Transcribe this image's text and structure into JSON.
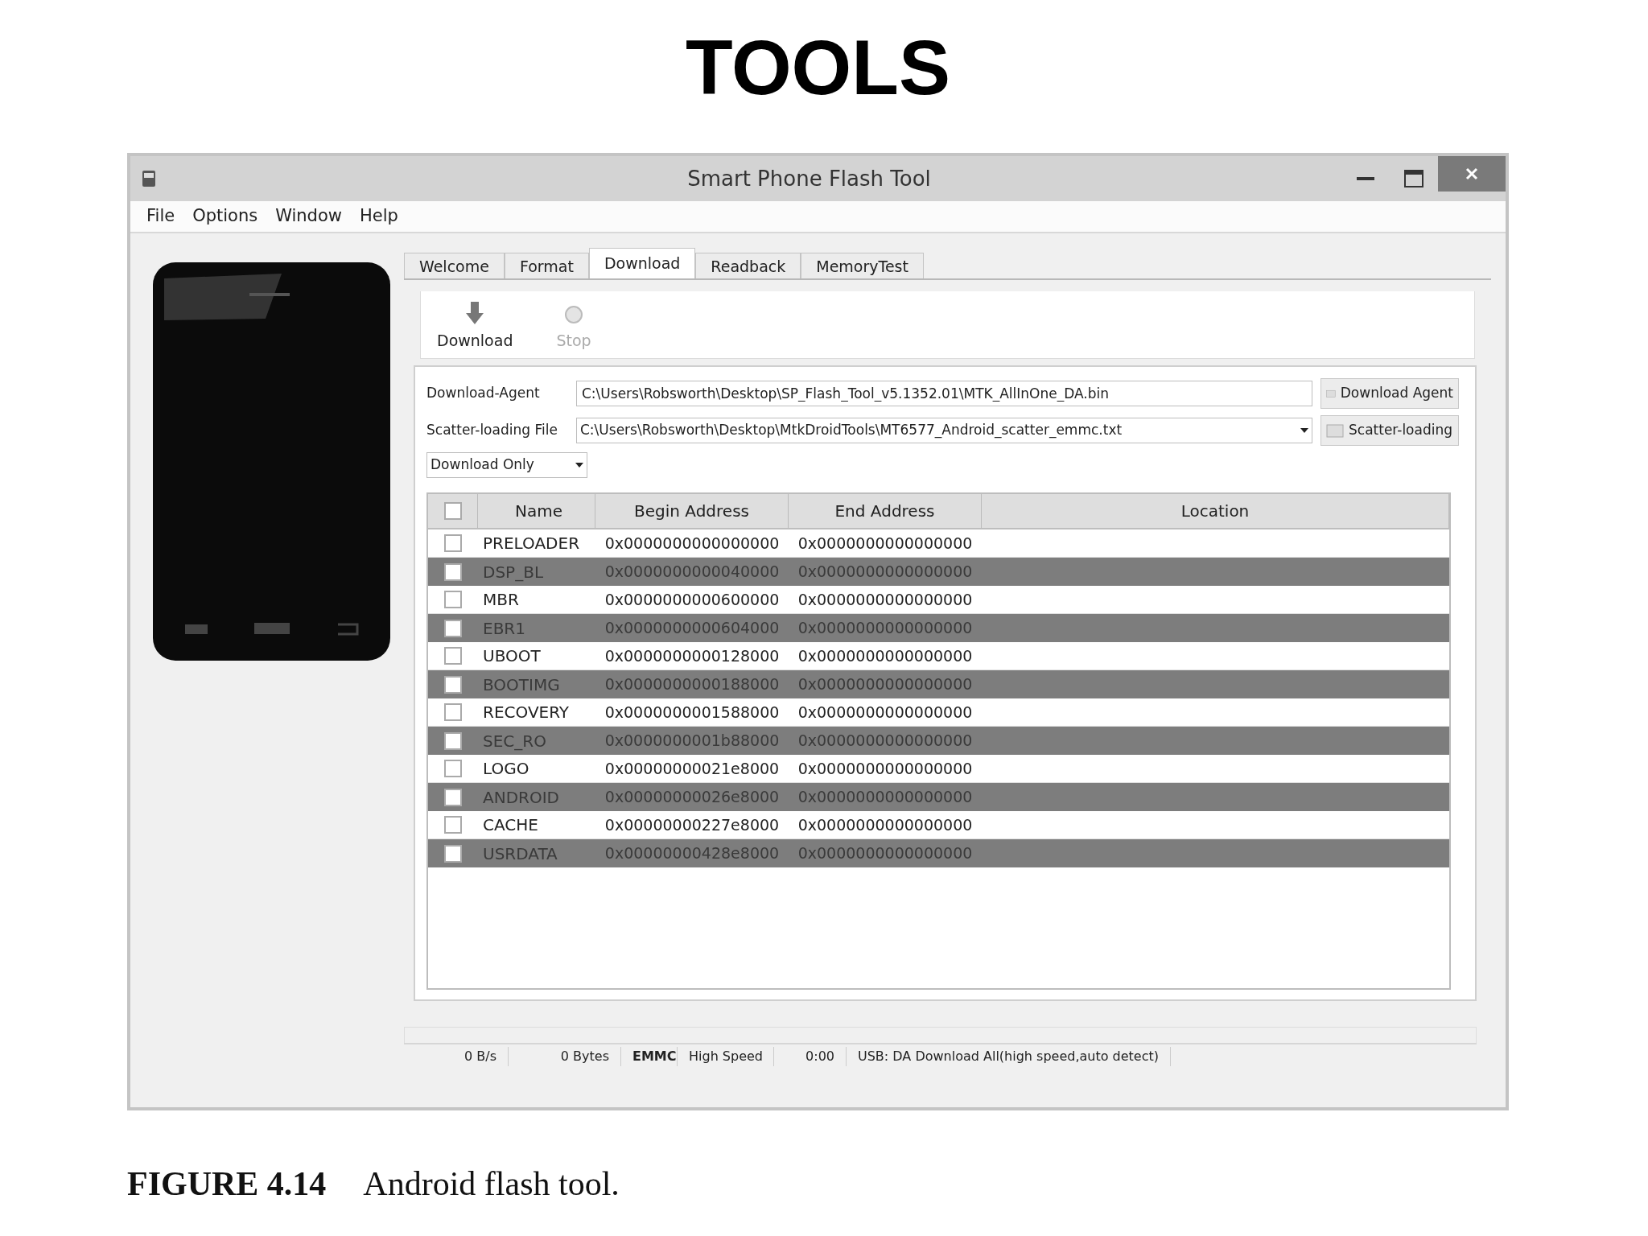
{
  "heading": "TOOLS",
  "window": {
    "title": "Smart Phone Flash Tool"
  },
  "menu": [
    "File",
    "Options",
    "Window",
    "Help"
  ],
  "tabs": [
    {
      "label": "Welcome",
      "selected": false
    },
    {
      "label": "Format",
      "selected": false
    },
    {
      "label": "Download",
      "selected": true
    },
    {
      "label": "Readback",
      "selected": false
    },
    {
      "label": "MemoryTest",
      "selected": false
    }
  ],
  "toolbar": [
    {
      "label": "Download",
      "kind": "download",
      "disabled": false
    },
    {
      "label": "Stop",
      "kind": "stop",
      "disabled": true
    }
  ],
  "download_agent": {
    "label": "Download-Agent",
    "value": "C:\\Users\\Robsworth\\Desktop\\SP_Flash_Tool_v5.1352.01\\MTK_AllInOne_DA.bin",
    "button": "Download Agent"
  },
  "scatter_file": {
    "label": "Scatter-loading File",
    "value": "C:\\Users\\Robsworth\\Desktop\\MtkDroidTools\\MT6577_Android_scatter_emmc.txt",
    "button": "Scatter-loading"
  },
  "mode": {
    "value": "Download Only"
  },
  "table": {
    "all_checked": false,
    "columns": [
      "Name",
      "Begin Address",
      "End Address",
      "Location"
    ],
    "rows": [
      {
        "name": "PRELOADER",
        "begin": "0x0000000000000000",
        "end": "0x0000000000000000",
        "checked": false,
        "selected": false
      },
      {
        "name": "DSP_BL",
        "begin": "0x0000000000040000",
        "end": "0x0000000000000000",
        "checked": false,
        "selected": true
      },
      {
        "name": "MBR",
        "begin": "0x0000000000600000",
        "end": "0x0000000000000000",
        "checked": false,
        "selected": false
      },
      {
        "name": "EBR1",
        "begin": "0x0000000000604000",
        "end": "0x0000000000000000",
        "checked": false,
        "selected": true
      },
      {
        "name": "UBOOT",
        "begin": "0x0000000000128000",
        "end": "0x0000000000000000",
        "checked": false,
        "selected": false
      },
      {
        "name": "BOOTIMG",
        "begin": "0x0000000000188000",
        "end": "0x0000000000000000",
        "checked": false,
        "selected": true
      },
      {
        "name": "RECOVERY",
        "begin": "0x0000000001588000",
        "end": "0x0000000000000000",
        "checked": false,
        "selected": false
      },
      {
        "name": "SEC_RO",
        "begin": "0x0000000001b88000",
        "end": "0x0000000000000000",
        "checked": false,
        "selected": true
      },
      {
        "name": "LOGO",
        "begin": "0x00000000021e8000",
        "end": "0x0000000000000000",
        "checked": false,
        "selected": false
      },
      {
        "name": "ANDROID",
        "begin": "0x00000000026e8000",
        "end": "0x0000000000000000",
        "checked": false,
        "selected": true
      },
      {
        "name": "CACHE",
        "begin": "0x00000000227e8000",
        "end": "0x0000000000000000",
        "checked": false,
        "selected": false
      },
      {
        "name": "USRDATA",
        "begin": "0x00000000428e8000",
        "end": "0x0000000000000000",
        "checked": false,
        "selected": true
      }
    ]
  },
  "status_bar": [
    {
      "text": "0 B/s",
      "emphasis": false
    },
    {
      "text": "0 Bytes",
      "emphasis": false
    },
    {
      "text": "EMMC",
      "emphasis": true
    },
    {
      "text": "High Speed",
      "emphasis": false
    },
    {
      "text": "0:00",
      "emphasis": false
    },
    {
      "text": "USB: DA Download All(high speed,auto detect)",
      "emphasis": false
    }
  ],
  "caption": {
    "number": "FIGURE 4.14",
    "text": "Android flash tool."
  }
}
